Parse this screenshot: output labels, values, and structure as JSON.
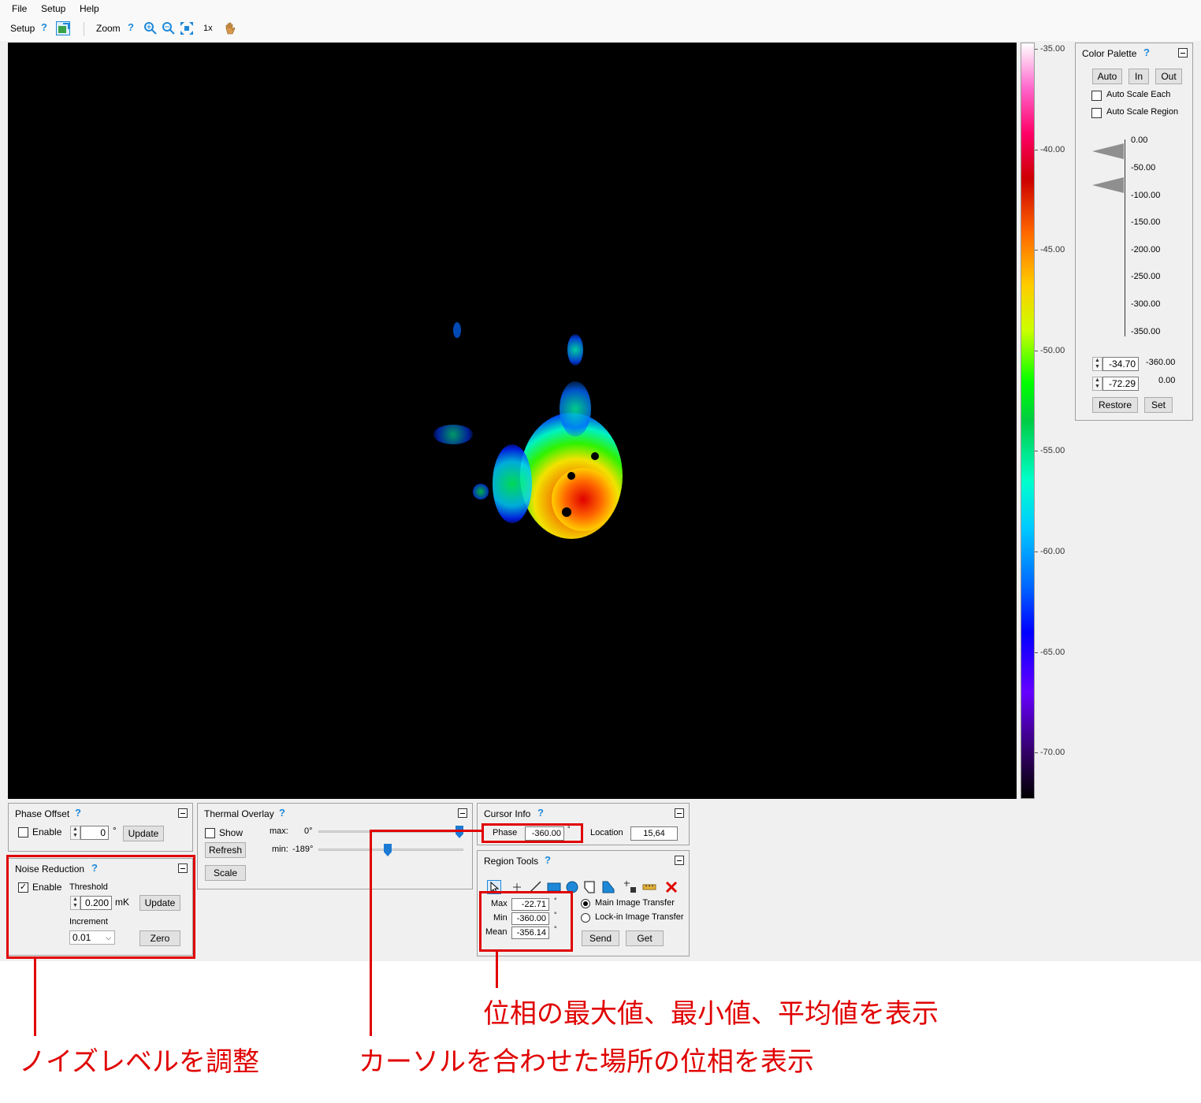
{
  "menu": {
    "items": [
      "File",
      "Setup",
      "Help"
    ]
  },
  "toolbar": {
    "setup_label": "Setup",
    "zoom_label": "Zoom",
    "zoom_level": "1x",
    "help": "?"
  },
  "colorbar": {
    "ticks": [
      "-35.00",
      "-40.00",
      "-45.00",
      "-50.00",
      "-55.00",
      "-60.00",
      "-65.00",
      "-70.00"
    ]
  },
  "color_palette": {
    "title": "Color Palette",
    "help": "?",
    "auto": "Auto",
    "in": "In",
    "out": "Out",
    "auto_scale_each": "Auto Scale Each",
    "auto_scale_region": "Auto Scale Region",
    "scale_ticks": [
      "0.00",
      "-50.00",
      "-100.00",
      "-150.00",
      "-200.00",
      "-250.00",
      "-300.00",
      "-350.00"
    ],
    "upper_value": "-34.70",
    "upper_limit": "-360.00",
    "lower_value": "-72.29",
    "lower_limit": "0.00",
    "restore": "Restore",
    "set": "Set"
  },
  "phase_offset": {
    "title": "Phase Offset",
    "help": "?",
    "enable": "Enable",
    "value": "0",
    "unit": "°",
    "update": "Update"
  },
  "thermal_overlay": {
    "title": "Thermal Overlay",
    "help": "?",
    "show": "Show",
    "refresh": "Refresh",
    "scale": "Scale",
    "max_label": "max:",
    "max_value": "0°",
    "min_label": "min:",
    "min_value": "-189°",
    "max_position": 1.0,
    "min_position": 0.47
  },
  "noise_reduction": {
    "title": "Noise Reduction",
    "help": "?",
    "enable": "Enable",
    "threshold_label": "Threshold",
    "threshold_value": "0.200",
    "threshold_unit": "mK",
    "update": "Update",
    "increment_label": "Increment",
    "increment_value": "0.01",
    "zero": "Zero"
  },
  "cursor_info": {
    "title": "Cursor Info",
    "help": "?",
    "phase_label": "Phase",
    "phase_value": "-360.00",
    "phase_unit": "°",
    "location_label": "Location",
    "location_value": "15,64"
  },
  "region_tools": {
    "title": "Region Tools",
    "help": "?",
    "max_label": "Max",
    "max_value": "-22.71",
    "min_label": "Min",
    "min_value": "-360.00",
    "mean_label": "Mean",
    "mean_value": "-356.14",
    "unit": "°",
    "main_transfer": "Main Image Transfer",
    "lockin_transfer": "Lock-in Image Transfer",
    "send": "Send",
    "get": "Get"
  },
  "annotations": {
    "stats": "位相の最大値、最小値、平均値を表示",
    "noise": "ノイズレベルを調整",
    "cursor": "カーソルを合わせた場所の位相を表示"
  }
}
